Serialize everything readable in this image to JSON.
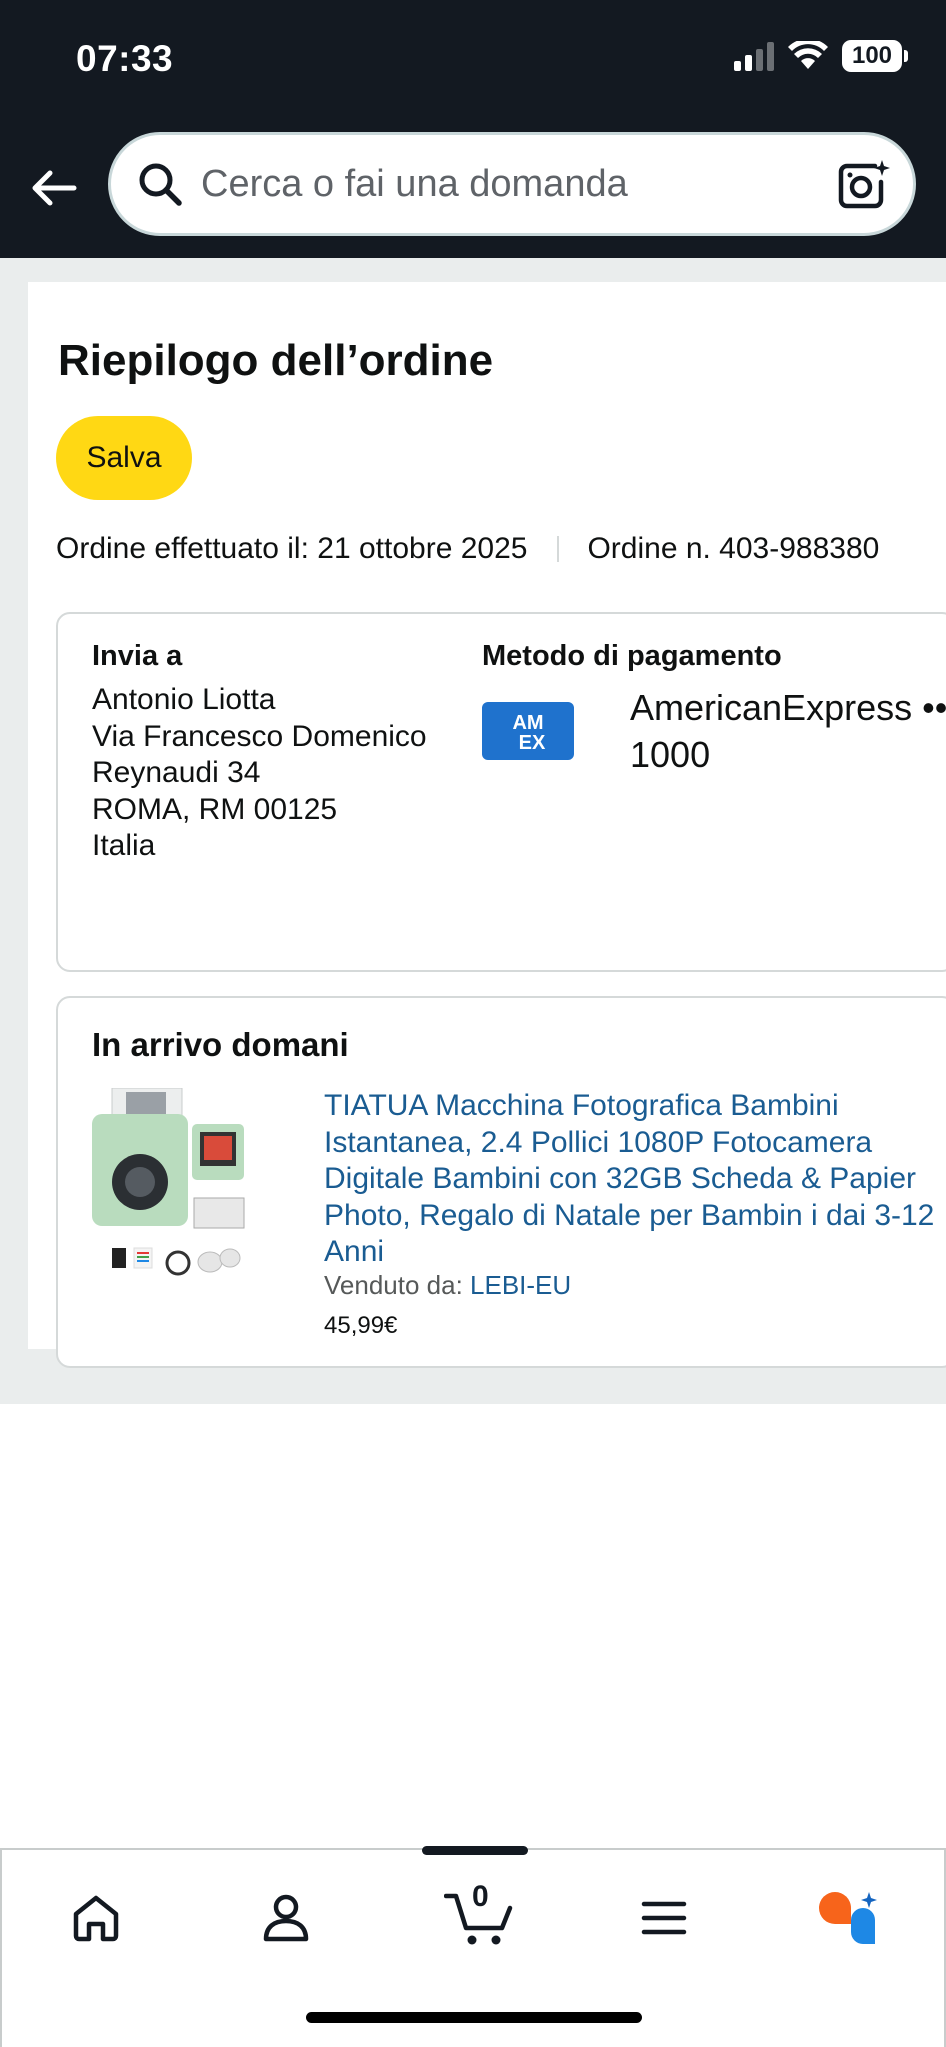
{
  "status_bar": {
    "time": "07:33",
    "battery": "100"
  },
  "search": {
    "placeholder": "Cerca o fai una domanda"
  },
  "order": {
    "title": "Riepilogo dell’ordine",
    "save_label": "Salva",
    "placed_on": "Ordine effettuato il: 21 ottobre 2025",
    "order_number": "Ordine n. 403-988380"
  },
  "shipping": {
    "label": "Invia a",
    "lines": [
      "Antonio Liotta",
      "Via Francesco Domenico",
      "Reynaudi 34",
      "ROMA, RM 00125",
      "Italia"
    ]
  },
  "payment": {
    "label": "Metodo di pagamento",
    "card_logo_text_1": "AM",
    "card_logo_text_2": "EX",
    "card_name": "AmericanExpress •••",
    "card_last": "1000"
  },
  "delivery": {
    "title": "In arrivo domani",
    "product_title": "TIATUA Macchina Fotografica Bambini Istantanea, 2.4 Pollici 1080P Fotocamera Digitale Bambini con 32GB Scheda & Papier Photo, Regalo di Natale per Bambin i dai 3-12 Anni",
    "sold_by_label": "Venduto da: ",
    "seller": "LEBI-EU",
    "price": "45,99€"
  },
  "bottom_nav": {
    "items": [
      "home-icon",
      "account-icon",
      "cart-icon",
      "menu-icon",
      "rufus-icon"
    ],
    "cart_count": "0"
  },
  "colors": {
    "header_bg": "#131921",
    "save_button": "#ffd814",
    "link": "#1a5c92",
    "amex_blue": "#1f72cd",
    "rufus_orange": "#f7641b",
    "rufus_blue": "#1e88e5"
  }
}
